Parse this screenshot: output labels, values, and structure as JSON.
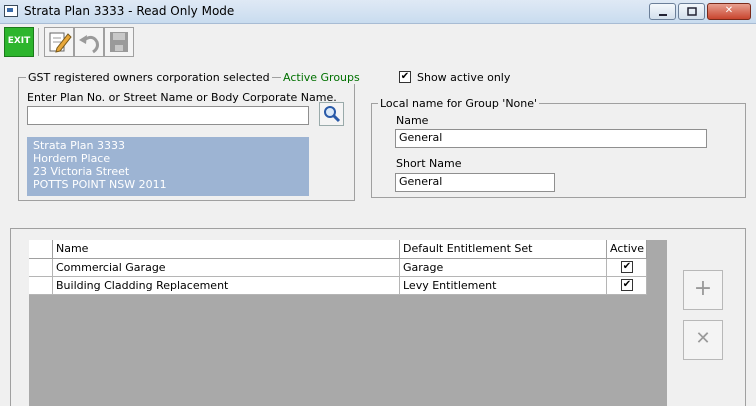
{
  "window": {
    "title": "Strata Plan 3333 - Read Only Mode",
    "minimize_icon": "minimize-icon",
    "maximize_icon": "maximize-icon",
    "close_icon": "close-icon",
    "close_glyph": "✕"
  },
  "toolbar": {
    "exit_label": "EXIT",
    "icons": [
      "edit-icon",
      "undo-icon",
      "save-icon"
    ]
  },
  "gst_group": {
    "legend": "GST registered owners corporation selected",
    "link": "Active Groups",
    "prompt": "Enter Plan No. or Street Name or Body Corporate Name.",
    "search_value": "",
    "address_lines": [
      "Strata Plan 3333",
      "Hordern Place",
      "23 Victoria Street",
      "POTTS POINT  NSW  2011"
    ]
  },
  "show_active_only": {
    "label": "Show active only",
    "checked": true
  },
  "local_name": {
    "legend": "Local name for Group 'None'",
    "name_label": "Name",
    "name_value": "General",
    "short_label": "Short Name",
    "short_value": "General"
  },
  "grid": {
    "columns": [
      "Name",
      "Default Entitlement Set",
      "Active"
    ],
    "rows": [
      {
        "name": "Commercial Garage",
        "set": "Garage",
        "active": true
      },
      {
        "name": "Building Cladding Replacement",
        "set": "Levy Entitlement",
        "active": true
      }
    ]
  },
  "side_buttons": {
    "add_glyph": "+",
    "remove_glyph": "✕"
  },
  "colors": {
    "exit_button": "#2db52d",
    "address_box": "#9db4d3",
    "grid_background": "#a9a9a9",
    "active_groups_link": "#007000"
  }
}
